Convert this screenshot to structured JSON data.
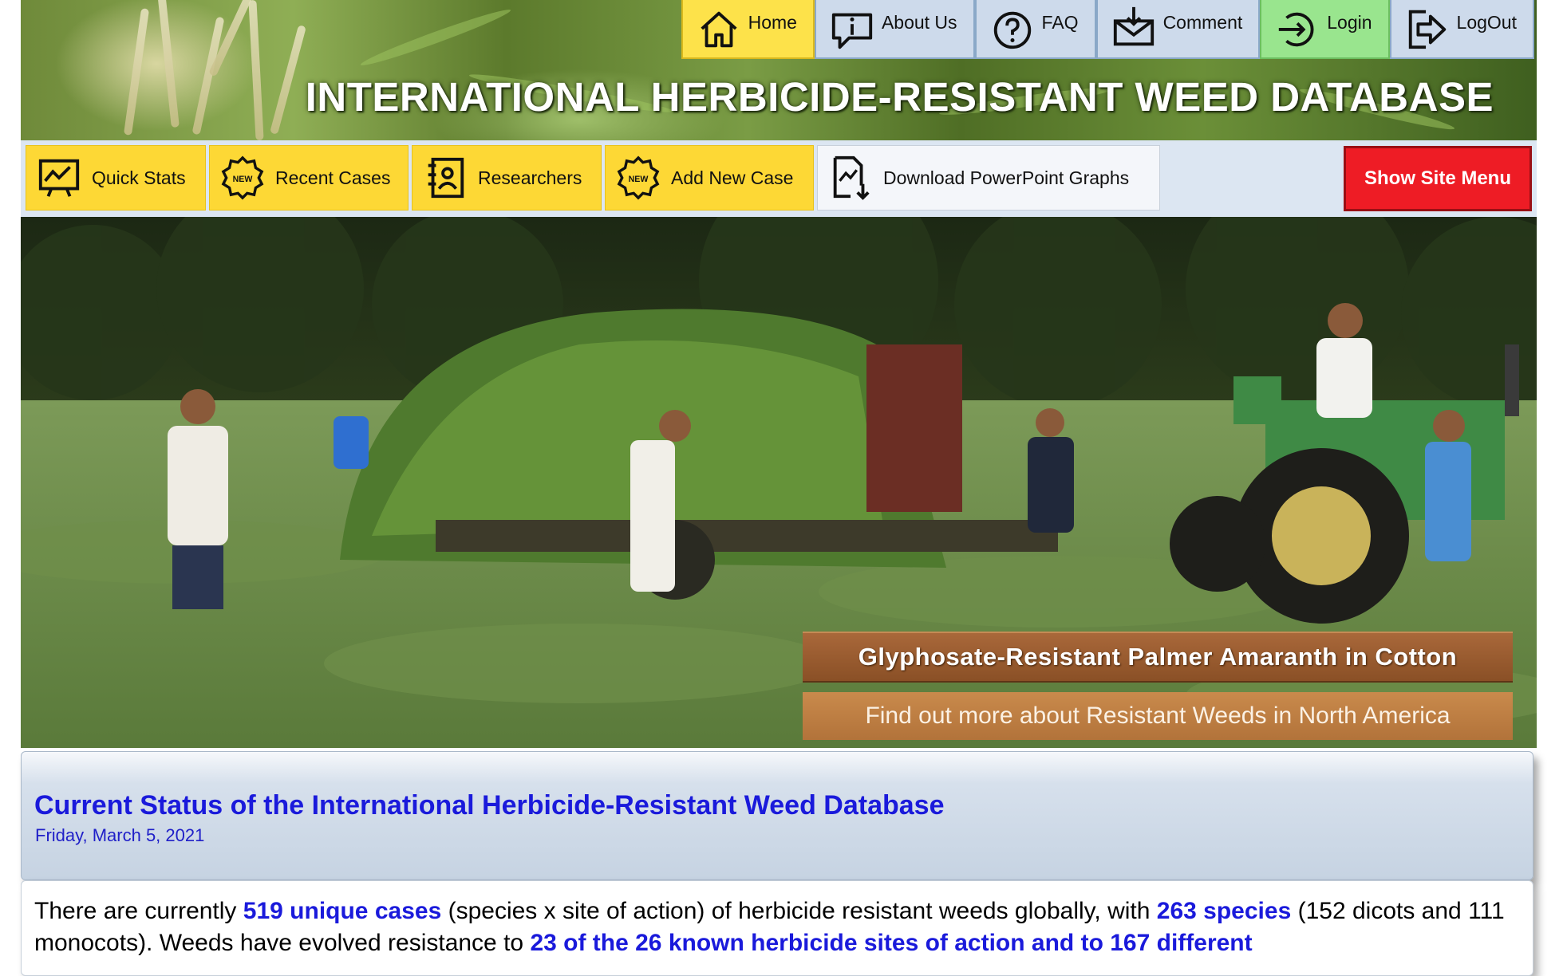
{
  "header": {
    "title": "INTERNATIONAL HERBICIDE-RESISTANT WEED DATABASE"
  },
  "top_nav": [
    {
      "label": "Home",
      "icon": "home-icon"
    },
    {
      "label": "About Us",
      "icon": "info-icon"
    },
    {
      "label": "FAQ",
      "icon": "question-icon"
    },
    {
      "label": "Comment",
      "icon": "comment-icon"
    },
    {
      "label": "Login",
      "icon": "login-icon"
    },
    {
      "label": "LogOut",
      "icon": "logout-icon"
    }
  ],
  "quick_bar": {
    "items": [
      {
        "label": "Quick Stats",
        "icon": "chart-icon"
      },
      {
        "label": "Recent Cases",
        "icon": "new-badge-icon"
      },
      {
        "label": "Researchers",
        "icon": "contact-book-icon"
      },
      {
        "label": "Add New Case",
        "icon": "new-badge-icon"
      },
      {
        "label": "Download PowerPoint Graphs",
        "icon": "download-chart-icon"
      }
    ],
    "show_menu_label": "Show Site Menu"
  },
  "hero": {
    "caption_title": "Glyphosate-Resistant Palmer Amaranth in Cotton",
    "caption_link": "Find out more about Resistant Weeds in North America"
  },
  "status": {
    "heading": "Current Status of the International Herbicide-Resistant Weed Database",
    "date": "Friday, March 5, 2021",
    "text_1": "There are currently ",
    "link_cases": "519 unique cases",
    "text_2": " (species x site of action) of herbicide resistant weeds globally, with ",
    "link_species": "263 species",
    "text_3": " (152 dicots and 111 monocots). Weeds have evolved resistance to ",
    "link_sites": "23 of the 26 known herbicide sites of action and to 167 different"
  },
  "colors": {
    "home_tab": "#fde24a",
    "login_tab": "#99e58e",
    "nav_tab": "#cddaeb",
    "quick_button": "#fdd835",
    "show_menu": "#ee1c25",
    "link_blue": "#1a1adb"
  }
}
